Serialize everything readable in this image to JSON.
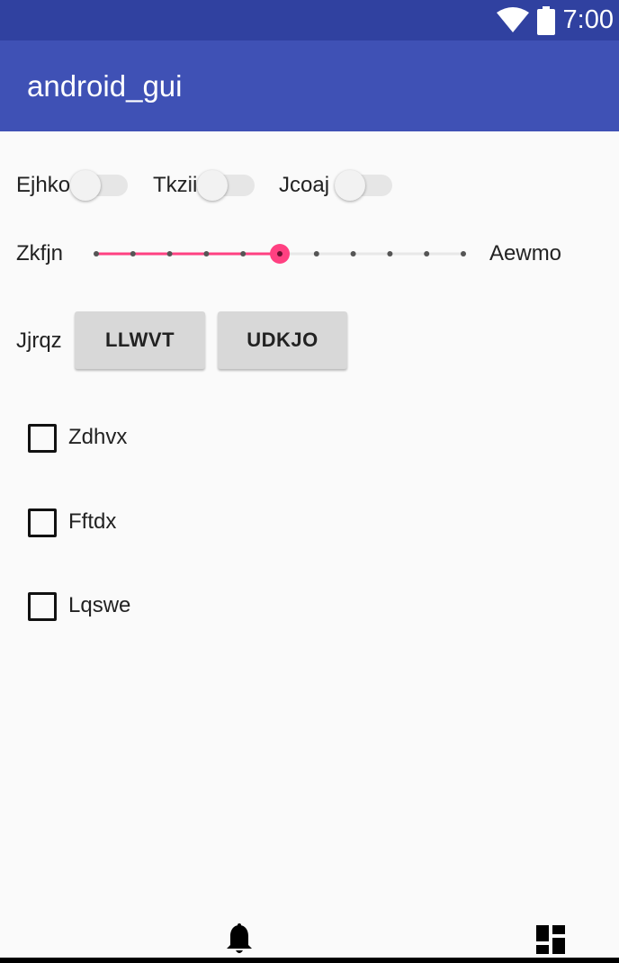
{
  "status_bar": {
    "time": "7:00",
    "icons": [
      "wifi-icon",
      "battery-icon"
    ]
  },
  "app_bar": {
    "title": "android_gui"
  },
  "switches": [
    {
      "label": "Ejhko",
      "checked": false
    },
    {
      "label": "Tkzii",
      "checked": false
    },
    {
      "label": "Jcoaj",
      "checked": false
    }
  ],
  "slider": {
    "min_label": "Zkfjn",
    "max_label": "Aewmo",
    "min": 0,
    "max": 10,
    "value": 5,
    "accent_color": "#ff4081"
  },
  "button_row": {
    "label": "Jjrqz",
    "buttons": [
      "LLWVT",
      "UDKJO"
    ]
  },
  "checkboxes": [
    {
      "label": "Zdhvx",
      "checked": false
    },
    {
      "label": "Fftdx",
      "checked": false
    },
    {
      "label": "Lqswe",
      "checked": false
    }
  ],
  "bottom_nav": {
    "icons": [
      "bell-icon",
      "dashboard-icon"
    ]
  },
  "colors": {
    "primary": "#3f51b5",
    "primary_dark": "#3041a0",
    "accent": "#ff4081"
  }
}
